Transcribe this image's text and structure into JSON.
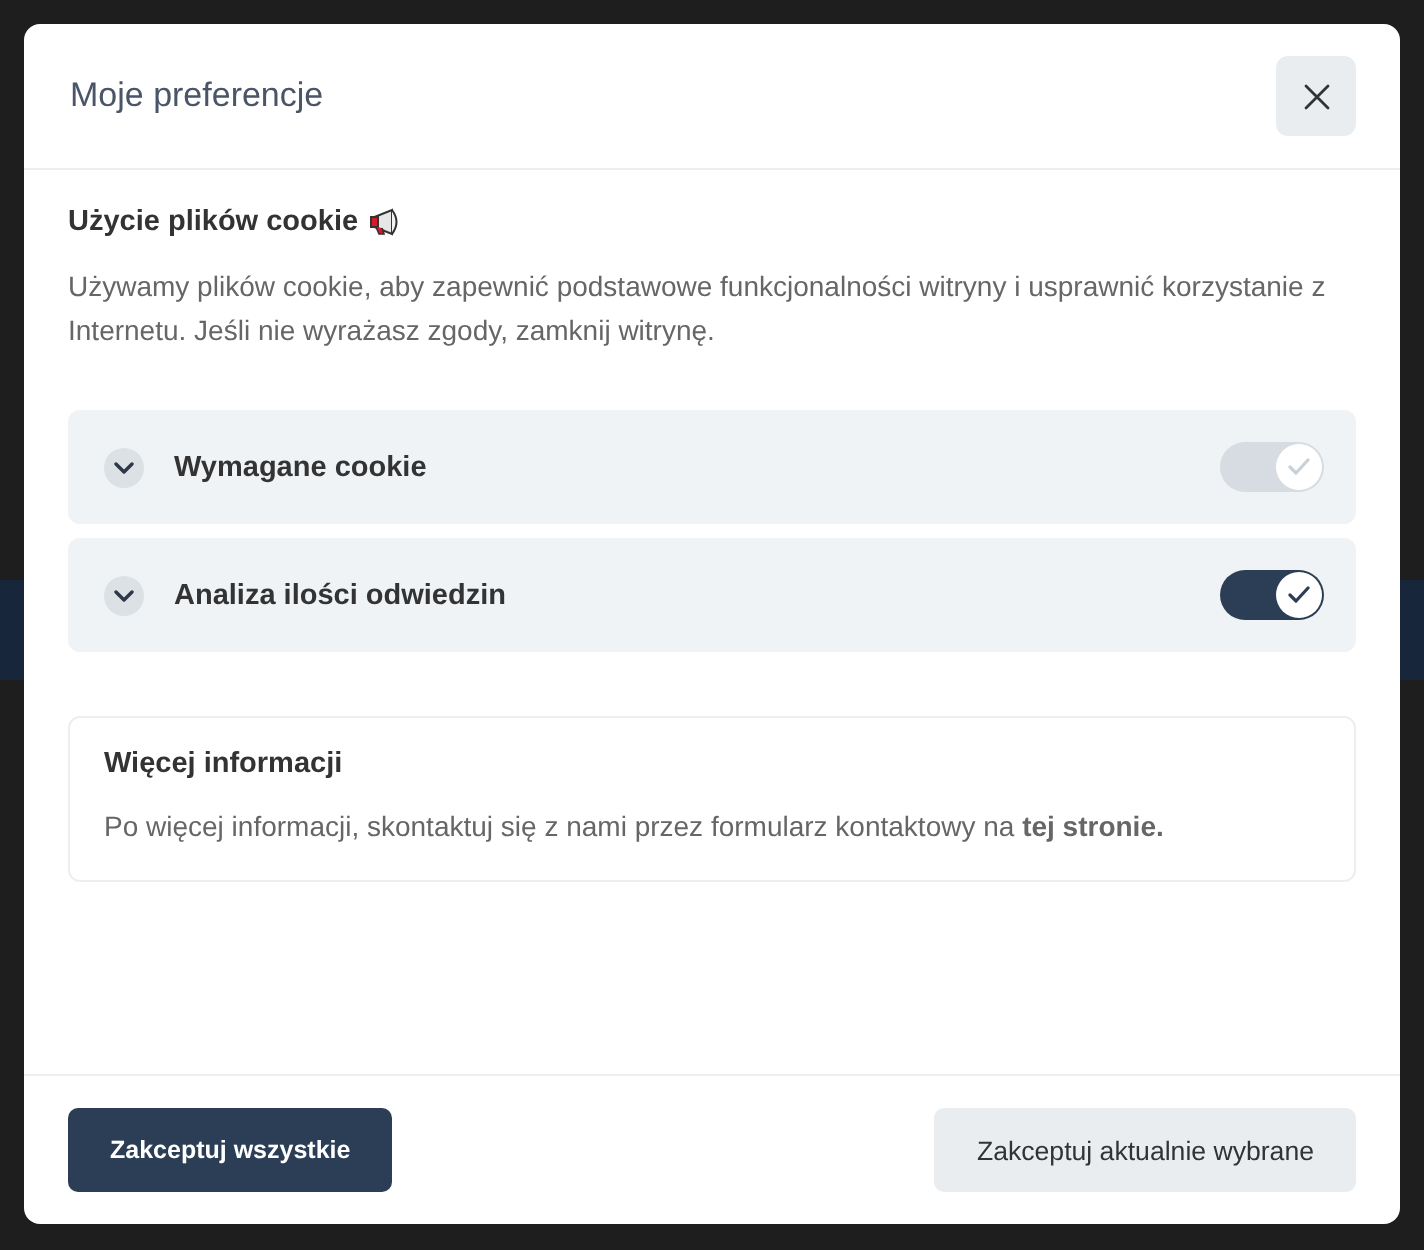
{
  "dialog": {
    "title": "Moje preferencje"
  },
  "intro": {
    "heading": "Użycie plików cookie",
    "text": "Używamy plików cookie, aby zapewnić podstawowe funkcjonalności witryny i usprawnić korzystanie z Internetu. Jeśli nie wyrażasz zgody, zamknij witrynę."
  },
  "categories": [
    {
      "label": "Wymagane cookie",
      "expanded": false,
      "checked": true,
      "disabled": true
    },
    {
      "label": "Analiza ilości odwiedzin",
      "expanded": false,
      "checked": true,
      "disabled": false
    }
  ],
  "more_info": {
    "heading": "Więcej informacji",
    "text": "Po więcej informacji, skontaktuj się z nami przez formularz kontaktowy na **tej stronie.**"
  },
  "buttons": [
    {
      "label": "Zakceptuj wszystkie",
      "kind": "primary"
    },
    {
      "label": "Zakceptuj aktualnie wybrane",
      "kind": "secondary"
    }
  ]
}
